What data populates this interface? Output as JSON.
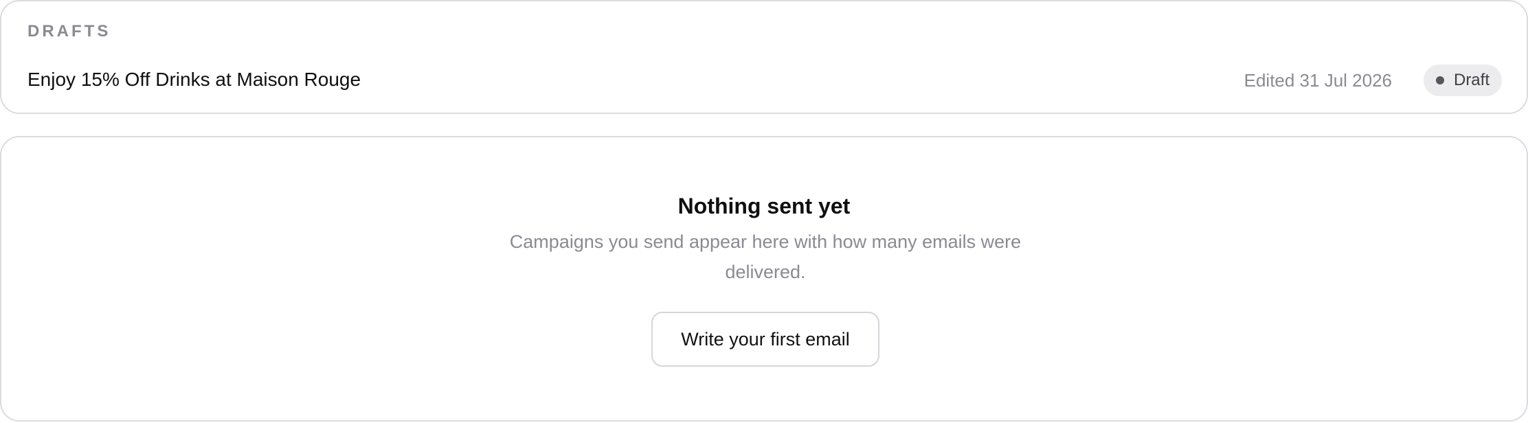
{
  "drafts": {
    "section_title": "DRAFTS",
    "items": [
      {
        "title": "Enjoy 15% Off Drinks at Maison Rouge",
        "edited": "Edited 31 Jul 2026",
        "status": "Draft"
      }
    ]
  },
  "sent": {
    "empty_title": "Nothing sent yet",
    "empty_text": "Campaigns you send appear here with how many emails were delivered.",
    "action_label": "Write your first email"
  },
  "colors": {
    "border": "#dcdcdf",
    "muted_text": "#8a8a92",
    "badge_bg": "#ececee"
  }
}
